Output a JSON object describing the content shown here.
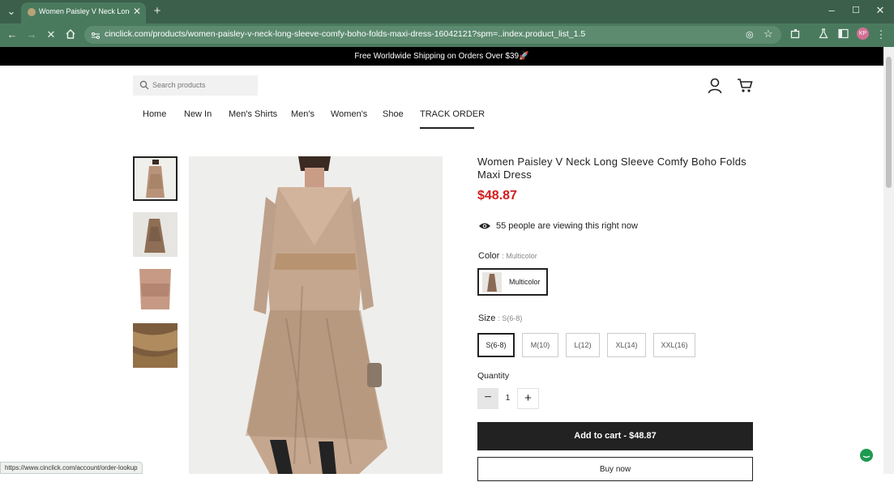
{
  "browser": {
    "tab_title": "Women Paisley V Neck Long Sl…",
    "url": "cinclick.com/products/women-paisley-v-neck-long-sleeve-comfy-boho-folds-maxi-dress-16042121?spm=..index.product_list_1.5",
    "status_url": "https://www.cinclick.com/account/order-lookup",
    "profile_initials": "KP",
    "window_controls": [
      "minimize",
      "maximize",
      "close"
    ]
  },
  "site": {
    "banner_text": "Free Worldwide Shipping on Orders Over $39🚀",
    "search_placeholder": "Search products",
    "nav": [
      "Home",
      "New In",
      "Men's Shirts",
      "Men's",
      "Women's",
      "Shoe",
      "TRACK ORDER"
    ]
  },
  "product": {
    "title": "Women Paisley V Neck Long Sleeve Comfy Boho Folds Maxi Dress",
    "price": "$48.87",
    "viewing_text": "55 people are viewing this right now",
    "color_label": "Color",
    "color_selected": ": Multicolor",
    "color_option": "Multicolor",
    "size_label": "Size",
    "size_selected": ": S(6-8)",
    "sizes": [
      "S(6-8)",
      "M(10)",
      "L(12)",
      "XL(14)",
      "XXL(16)"
    ],
    "quantity_label": "Quantity",
    "quantity": "1",
    "add_to_cart": "Add to cart  -  $48.87",
    "buy_now": "Buy now"
  },
  "colors": {
    "browser_chrome": "#3b5f4a",
    "price": "#d21c1c",
    "button_dark": "#222222"
  }
}
